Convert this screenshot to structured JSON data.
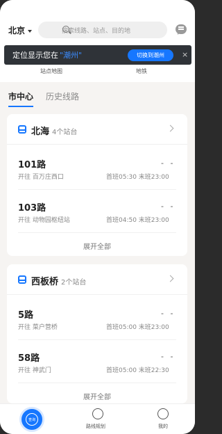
{
  "header": {
    "city": "北京",
    "search_placeholder": "搜索线路、站点、目的地",
    "toast": {
      "prefix": "定位显示您在",
      "city": "\"潮州\"",
      "button": "切换到潮州",
      "close": "×"
    },
    "sub_labels": [
      "站点地图",
      "地铁"
    ]
  },
  "tabs": [
    {
      "label": "市中心",
      "active": true
    },
    {
      "label": "历史线路",
      "active": false
    }
  ],
  "cards": [
    {
      "stop_name": "北海",
      "stop_count": "4个站台",
      "routes": [
        {
          "number": "101路",
          "direction": "开往 百万庄西口",
          "time": "首班05:30 末班23:00",
          "eta": "- -"
        },
        {
          "number": "103路",
          "direction": "开往 动物园枢纽站",
          "time": "首班04:50 末班23:00",
          "eta": "- -"
        }
      ],
      "expand": "展开全部"
    },
    {
      "stop_name": "西板桥",
      "stop_count": "2个站台",
      "routes": [
        {
          "number": "5路",
          "direction": "开往 菜户营桥",
          "time": "首班05:00 末班23:00",
          "eta": "- -"
        },
        {
          "number": "58路",
          "direction": "开往 神武门",
          "time": "首班05:00 末班22:30",
          "eta": "- -"
        }
      ],
      "expand": "展开全部"
    }
  ],
  "bottom_nav": [
    {
      "label": "",
      "icon": "bus-query-icon",
      "active": true,
      "fab_text": "查询"
    },
    {
      "label": "路线规划",
      "icon": "route-plan-icon"
    },
    {
      "label": "我的",
      "icon": "profile-icon"
    }
  ],
  "colors": {
    "accent": "#1677ff",
    "toast_bg": "#2f3338"
  }
}
